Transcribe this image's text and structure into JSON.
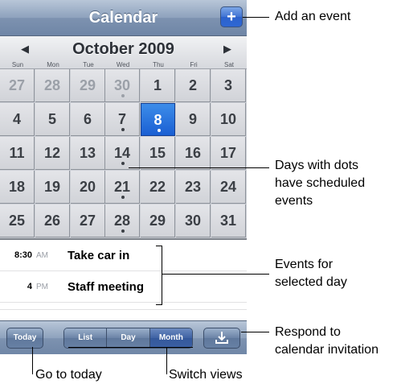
{
  "nav": {
    "title": "Calendar",
    "add_symbol": "+"
  },
  "month": {
    "title": "October 2009",
    "prev": "◀",
    "next": "▶",
    "weekdays": [
      "Sun",
      "Mon",
      "Tue",
      "Wed",
      "Thu",
      "Fri",
      "Sat"
    ]
  },
  "days": [
    {
      "label": "27",
      "dim": true
    },
    {
      "label": "28",
      "dim": true
    },
    {
      "label": "29",
      "dim": true
    },
    {
      "label": "30",
      "dim": true,
      "dot": true
    },
    {
      "label": "1"
    },
    {
      "label": "2"
    },
    {
      "label": "3"
    },
    {
      "label": "4"
    },
    {
      "label": "5"
    },
    {
      "label": "6"
    },
    {
      "label": "7",
      "dot": true
    },
    {
      "label": "8",
      "selected": true,
      "dot": true
    },
    {
      "label": "9"
    },
    {
      "label": "10"
    },
    {
      "label": "11"
    },
    {
      "label": "12"
    },
    {
      "label": "13"
    },
    {
      "label": "14",
      "dot": true
    },
    {
      "label": "15"
    },
    {
      "label": "16"
    },
    {
      "label": "17"
    },
    {
      "label": "18"
    },
    {
      "label": "19"
    },
    {
      "label": "20"
    },
    {
      "label": "21",
      "dot": true
    },
    {
      "label": "22"
    },
    {
      "label": "23"
    },
    {
      "label": "24"
    },
    {
      "label": "25"
    },
    {
      "label": "26"
    },
    {
      "label": "27"
    },
    {
      "label": "28",
      "dot": true
    },
    {
      "label": "29"
    },
    {
      "label": "30"
    },
    {
      "label": "31"
    }
  ],
  "events": [
    {
      "time": "8:30",
      "ampm": "AM",
      "title": "Take car in"
    },
    {
      "time": "4",
      "ampm": "PM",
      "title": "Staff meeting"
    }
  ],
  "toolbar": {
    "today": "Today",
    "views": [
      "List",
      "Day",
      "Month"
    ],
    "active_view": "Month",
    "respond_icon": "download-icon"
  },
  "annotations": {
    "add_event": "Add an event",
    "dots": "Days with dots\nhave scheduled\nevents",
    "events": "Events for\nselected day",
    "respond": "Respond to\ncalendar invitation",
    "today": "Go to today",
    "views": "Switch views"
  }
}
